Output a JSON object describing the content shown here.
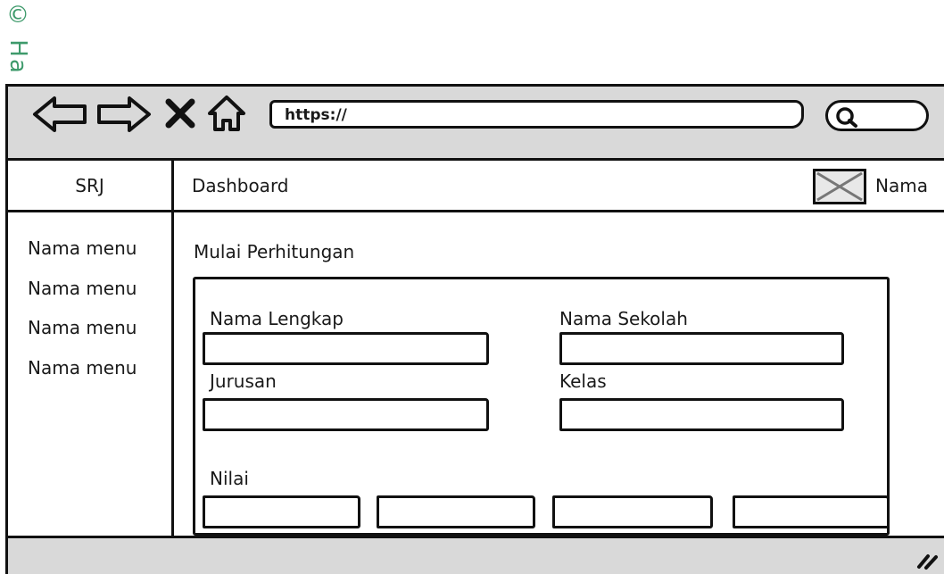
{
  "watermark": {
    "text": "© Ha"
  },
  "browser": {
    "url": "https://",
    "icons": [
      "back-arrow-icon",
      "forward-arrow-icon",
      "close-x-icon",
      "home-icon",
      "search-icon",
      "resize-grip-icon"
    ]
  },
  "sidebar": {
    "brand": "SRJ",
    "items": [
      {
        "label": "Nama menu"
      },
      {
        "label": "Nama menu"
      },
      {
        "label": "Nama menu"
      },
      {
        "label": "Nama menu"
      }
    ]
  },
  "header": {
    "title": "Dashboard",
    "user_name": "Nama"
  },
  "main": {
    "title": "Mulai Perhitungan",
    "form": {
      "nama_lengkap": {
        "label": "Nama Lengkap",
        "value": ""
      },
      "nama_sekolah": {
        "label": "Nama Sekolah",
        "value": ""
      },
      "jurusan": {
        "label": "Jurusan",
        "value": ""
      },
      "kelas": {
        "label": "Kelas",
        "value": ""
      },
      "nilai": {
        "label": "Nilai",
        "values": [
          "",
          "",
          "",
          ""
        ]
      }
    }
  },
  "colors": {
    "toolbar_bg": "#d9d9d9",
    "stroke": "#111111",
    "watermark": "#3e9a6b"
  }
}
